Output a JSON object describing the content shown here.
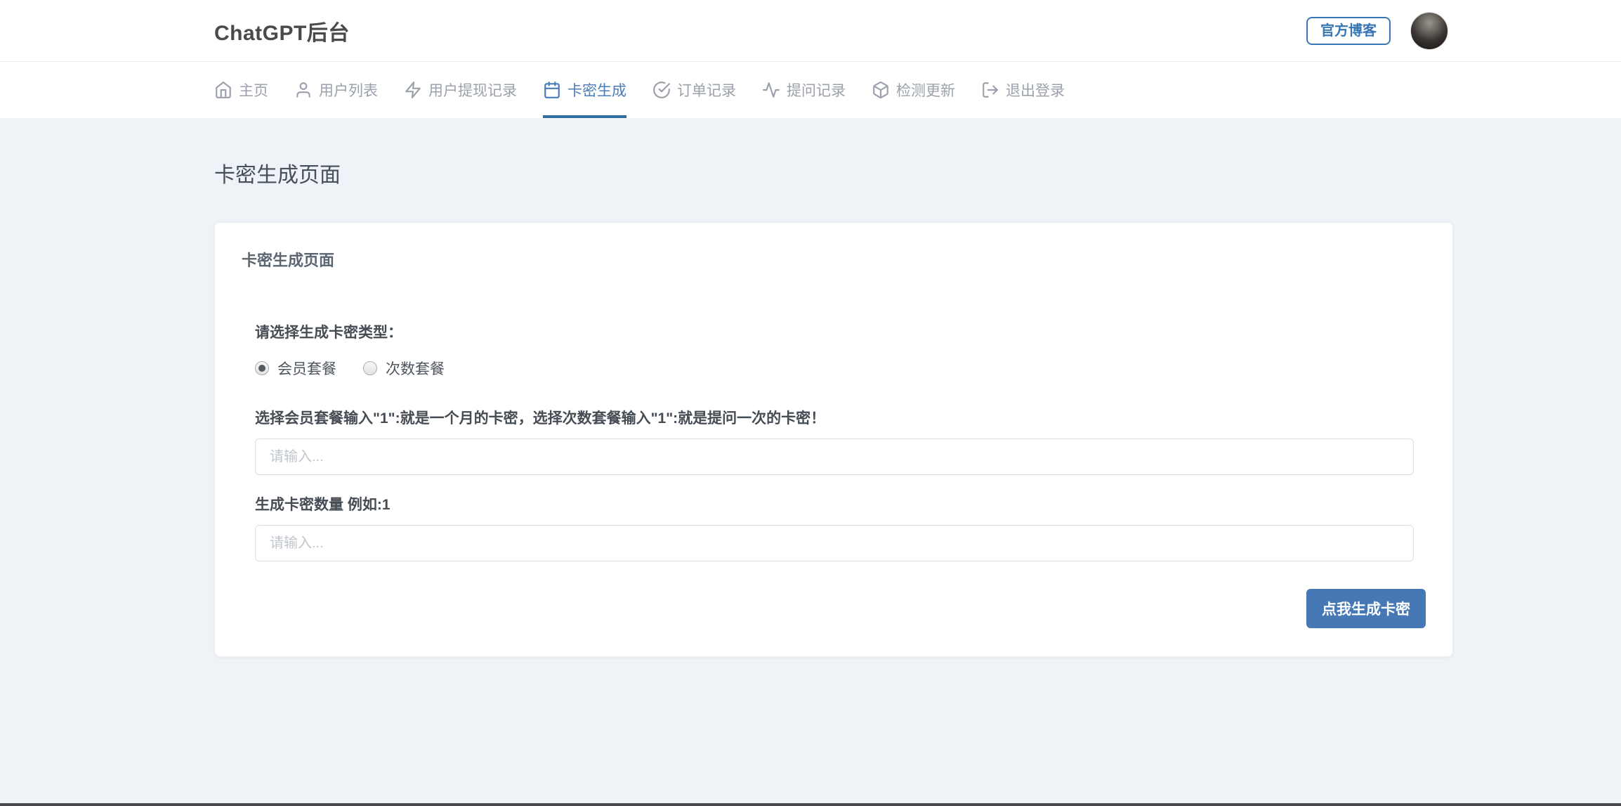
{
  "header": {
    "title": "ChatGPT后台",
    "blog_button_label": "官方博客"
  },
  "nav": {
    "items": [
      {
        "label": "主页",
        "icon": "home-icon",
        "active": false
      },
      {
        "label": "用户列表",
        "icon": "user-icon",
        "active": false
      },
      {
        "label": "用户提现记录",
        "icon": "zap-icon",
        "active": false
      },
      {
        "label": "卡密生成",
        "icon": "calendar-icon",
        "active": true
      },
      {
        "label": "订单记录",
        "icon": "check-circle-icon",
        "active": false
      },
      {
        "label": "提问记录",
        "icon": "activity-icon",
        "active": false
      },
      {
        "label": "检测更新",
        "icon": "box-icon",
        "active": false
      },
      {
        "label": "退出登录",
        "icon": "logout-icon",
        "active": false
      }
    ]
  },
  "page": {
    "title": "卡密生成页面"
  },
  "card": {
    "title": "卡密生成页面",
    "type_label": "请选择生成卡密类型：",
    "radios": [
      {
        "label": "会员套餐",
        "checked": true
      },
      {
        "label": "次数套餐",
        "checked": false
      }
    ],
    "value_label": "选择会员套餐输入\"1\":就是一个月的卡密，选择次数套餐输入\"1\":就是提问一次的卡密！",
    "value_placeholder": "请输入...",
    "count_label": "生成卡密数量 例如:1",
    "count_placeholder": "请输入...",
    "submit_button_label": "点我生成卡密"
  },
  "colors": {
    "accent_blue": "#4a7cba",
    "active_underline": "#2e6f9e",
    "button_blue": "#4678b6",
    "outline_button_blue": "#3876b4",
    "page_background": "#eff2f6",
    "inactive_nav_gray": "#9ba1ac"
  }
}
